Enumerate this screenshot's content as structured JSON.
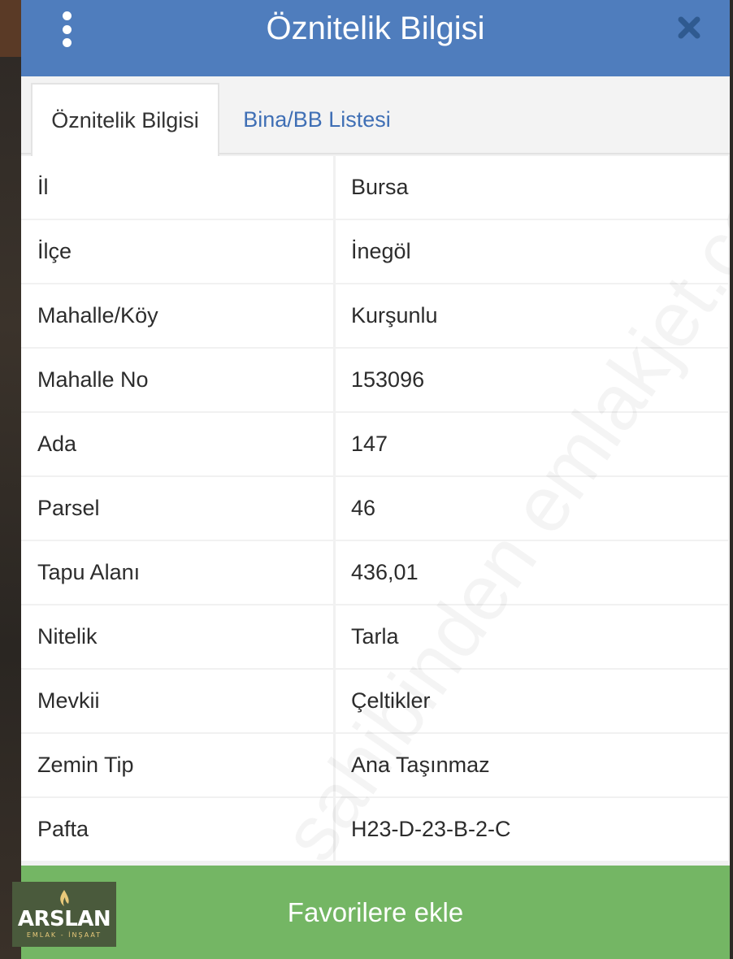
{
  "header": {
    "title": "Öznitelik Bilgisi",
    "menu_icon": "kebab-menu-icon",
    "close_icon": "close-icon"
  },
  "tabs": [
    {
      "label": "Öznitelik Bilgisi",
      "active": true
    },
    {
      "label": "Bina/BB Listesi",
      "active": false
    }
  ],
  "attributes": [
    {
      "label": "İl",
      "value": "Bursa"
    },
    {
      "label": "İlçe",
      "value": "İnegöl"
    },
    {
      "label": "Mahalle/Köy",
      "value": "Kurşunlu"
    },
    {
      "label": "Mahalle No",
      "value": "153096"
    },
    {
      "label": "Ada",
      "value": "147"
    },
    {
      "label": "Parsel",
      "value": "46"
    },
    {
      "label": "Tapu Alanı",
      "value": "436,01"
    },
    {
      "label": "Nitelik",
      "value": "Tarla"
    },
    {
      "label": "Mevkii",
      "value": "Çeltikler"
    },
    {
      "label": "Zemin Tip",
      "value": "Ana Taşınmaz"
    },
    {
      "label": "Pafta",
      "value": "H23-D-23-B-2-C"
    }
  ],
  "favorite_button": {
    "label": "Favorilere ekle"
  },
  "watermark": {
    "text": "sahibinden emlakjet.com"
  },
  "logo": {
    "name": "ARSLAN",
    "tagline": "EMLAK - İNŞAAT"
  },
  "colors": {
    "header": "#4f7dbd",
    "tab_link": "#3f6fb5",
    "favorite_button": "#74b664"
  }
}
